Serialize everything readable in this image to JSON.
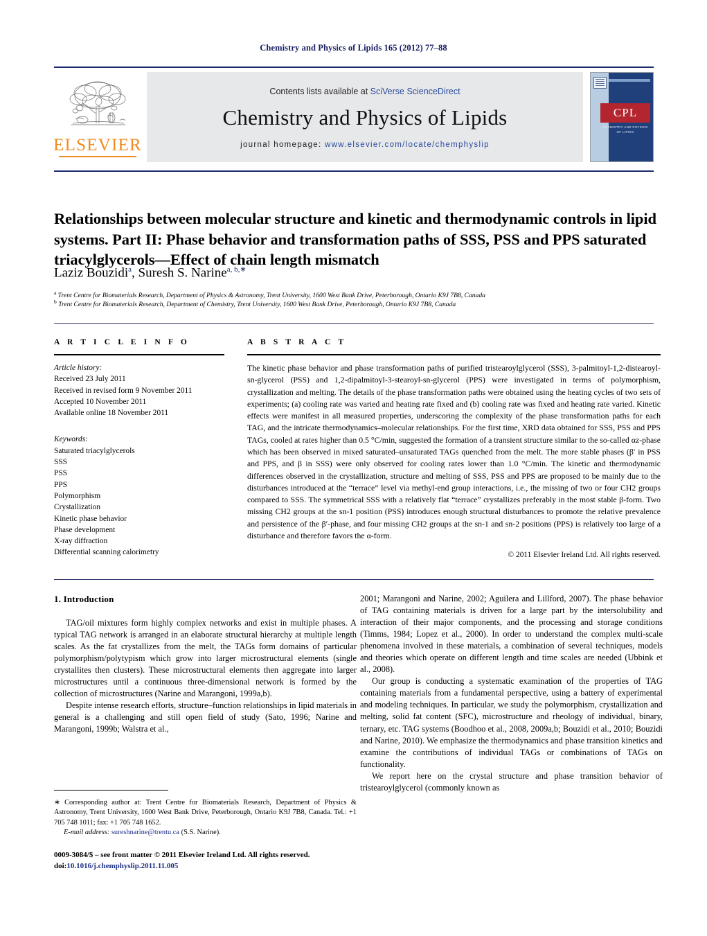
{
  "running_head": "Chemistry and Physics of Lipids 165 (2012) 77–88",
  "masthead": {
    "contents_prefix": "Contents lists available at ",
    "sciencedirect": "SciVerse ScienceDirect",
    "journal_name": "Chemistry and Physics of Lipids",
    "homepage_prefix": "journal homepage: ",
    "homepage_url": "www.elsevier.com/locate/chemphyslip",
    "publisher_logo_text": "ELSEVIER",
    "cover": {
      "title_abbrev": "CPL",
      "subtitle": "CHEMISTRY AND PHYSICS OF LIPIDS"
    }
  },
  "article": {
    "title": "Relationships between molecular structure and kinetic and thermodynamic controls in lipid systems. Part II: Phase behavior and transformation paths of SSS, PSS and PPS saturated triacylglycerols—Effect of chain length mismatch",
    "authors": [
      {
        "name": "Laziz Bouzidi",
        "marks": "a"
      },
      {
        "name": "Suresh S. Narine",
        "marks": "a, b,∗"
      }
    ],
    "affiliations": [
      {
        "mark": "a",
        "text": "Trent Centre for Biomaterials Research, Department of Physics & Astronomy, Trent University, 1600 West Bank Drive, Peterborough, Ontario K9J 7B8, Canada"
      },
      {
        "mark": "b",
        "text": "Trent Centre for Biomaterials Research, Department of Chemistry, Trent University, 1600 West Bank Drive, Peterborough, Ontario K9J 7B8, Canada"
      }
    ]
  },
  "article_info": {
    "heading": "A R T I C L E    I N F O",
    "history_label": "Article history:",
    "history": [
      "Received 23 July 2011",
      "Received in revised form 9 November 2011",
      "Accepted 10 November 2011",
      "Available online 18 November 2011"
    ],
    "keywords_label": "Keywords:",
    "keywords": [
      "Saturated triacylglycerols",
      "SSS",
      "PSS",
      "PPS",
      "Polymorphism",
      "Crystallization",
      "Kinetic phase behavior",
      "Phase development",
      "X-ray diffraction",
      "Differential scanning calorimetry"
    ]
  },
  "abstract": {
    "heading": "A B S T R A C T",
    "text": "The kinetic phase behavior and phase transformation paths of purified tristearoylglycerol (SSS), 3-palmitoyl-1,2-distearoyl-sn-glycerol (PSS) and 1,2-dipalmitoyl-3-stearoyl-sn-glycerol (PPS) were investigated in terms of polymorphism, crystallization and melting. The details of the phase transformation paths were obtained using the heating cycles of two sets of experiments; (a) cooling rate was varied and heating rate fixed and (b) cooling rate was fixed and heating rate varied. Kinetic effects were manifest in all measured properties, underscoring the complexity of the phase transformation paths for each TAG, and the intricate thermodynamics–molecular relationships. For the first time, XRD data obtained for SSS, PSS and PPS TAGs, cooled at rates higher than 0.5 °C/min, suggested the formation of a transient structure similar to the so-called αz-phase which has been observed in mixed saturated–unsaturated TAGs quenched from the melt. The more stable phases (β′ in PSS and PPS, and β in SSS) were only observed for cooling rates lower than 1.0 °C/min. The kinetic and thermodynamic differences observed in the crystallization, structure and melting of SSS, PSS and PPS are proposed to be mainly due to the disturbances introduced at the “terrace” level via methyl-end group interactions, i.e., the missing of two or four CH2 groups compared to SSS. The symmetrical SSS with a relatively flat “terrace” crystallizes preferably in the most stable β-form. Two missing CH2 groups at the sn-1 position (PSS) introduces enough structural disturbances to promote the relative prevalence and persistence of the β′-phase, and four missing CH2 groups at the sn-1 and sn-2 positions (PPS) is relatively too large of a disturbance and therefore favors the α-form.",
    "copyright": "© 2011 Elsevier Ireland Ltd. All rights reserved."
  },
  "body": {
    "section_heading": "1. Introduction",
    "left_paragraphs": [
      "TAG/oil mixtures form highly complex networks and exist in multiple phases. A typical TAG network is arranged in an elaborate structural hierarchy at multiple length scales. As the fat crystallizes from the melt, the TAGs form domains of particular polymorphism/polytypism which grow into larger microstructural elements (single crystallites then clusters). These microstructural elements then aggregate into larger microstructures until a continuous three-dimensional network is formed by the collection of microstructures (Narine and Marangoni, 1999a,b).",
      "Despite intense research efforts, structure–function relationships in lipid materials in general is a challenging and still open field of study (Sato, 1996; Narine and Marangoni, 1999b; Walstra et al.,"
    ],
    "right_paragraphs": [
      "2001; Marangoni and Narine, 2002; Aguilera and Lillford, 2007). The phase behavior of TAG containing materials is driven for a large part by the intersolubility and interaction of their major components, and the processing and storage conditions (Timms, 1984; Lopez et al., 2000). In order to understand the complex multi-scale phenomena involved in these materials, a combination of several techniques, models and theories which operate on different length and time scales are needed (Ubbink et al., 2008).",
      "Our group is conducting a systematic examination of the properties of TAG containing materials from a fundamental perspective, using a battery of experimental and modeling techniques. In particular, we study the polymorphism, crystallization and melting, solid fat content (SFC), microstructure and rheology of individual, binary, ternary, etc. TAG systems (Boodhoo et al., 2008, 2009a,b; Bouzidi et al., 2010; Bouzidi and Narine, 2010). We emphasize the thermodynamics and phase transition kinetics and examine the contributions of individual TAGs or combinations of TAGs on functionality.",
      "We report here on the crystal structure and phase transition behavior of tristearoylglycerol (commonly known as"
    ]
  },
  "footnotes": {
    "corresponding": "∗ Corresponding author at: Trent Centre for Biomaterials Research, Department of Physics & Astronomy, Trent University, 1600 West Bank Drive, Peterborough, Ontario K9J 7B8, Canada. Tel.: +1 705 748 1011; fax: +1 705 748 1652.",
    "email_label": "E-mail address:",
    "email": "sureshnarine@trentu.ca",
    "email_owner": "(S.S. Narine).",
    "issn_line": "0009-3084/$ – see front matter © 2011 Elsevier Ireland Ltd. All rights reserved.",
    "doi_label": "doi:",
    "doi": "10.1016/j.chemphyslip.2011.11.005"
  },
  "colors": {
    "link": "#1c2f85",
    "header_blue": "#151d63",
    "elsevier_orange": "#f18a21",
    "band_gray": "#e7e8ea",
    "cover_navy": "#20407c",
    "cover_red": "#b4262f"
  }
}
